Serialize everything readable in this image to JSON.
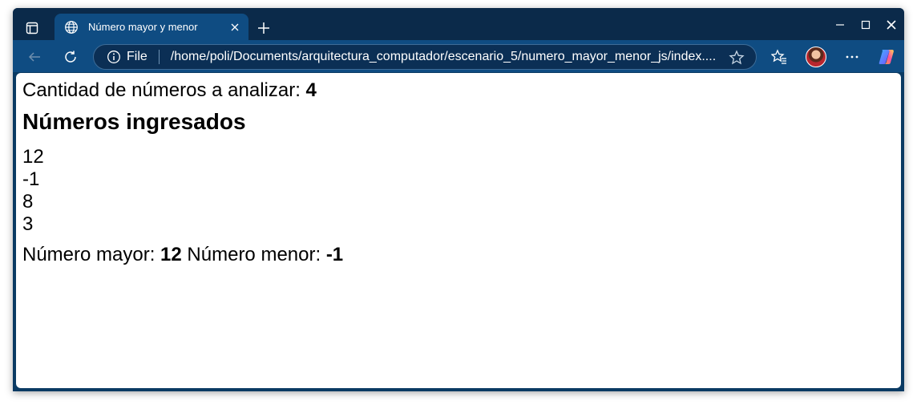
{
  "browser": {
    "tab": {
      "title": "Número mayor y menor",
      "favicon": "globe-icon"
    },
    "address_bar": {
      "scheme_label": "File",
      "url": "/home/poli/Documents/arquitectura_computador/escenario_5/numero_mayor_menor_js/index...."
    },
    "colors": {
      "titlebar": "#0b2a4a",
      "toolbar": "#0f4c82",
      "frame": "#0a3a63"
    }
  },
  "page": {
    "count_label": "Cantidad de números a analizar: ",
    "count_value": "4",
    "heading": "Números ingresados",
    "numbers": [
      "12",
      "-1",
      "8",
      "3"
    ],
    "max_label": "Número mayor: ",
    "max_value": "12",
    "min_label": " Número menor: ",
    "min_value": "-1"
  }
}
